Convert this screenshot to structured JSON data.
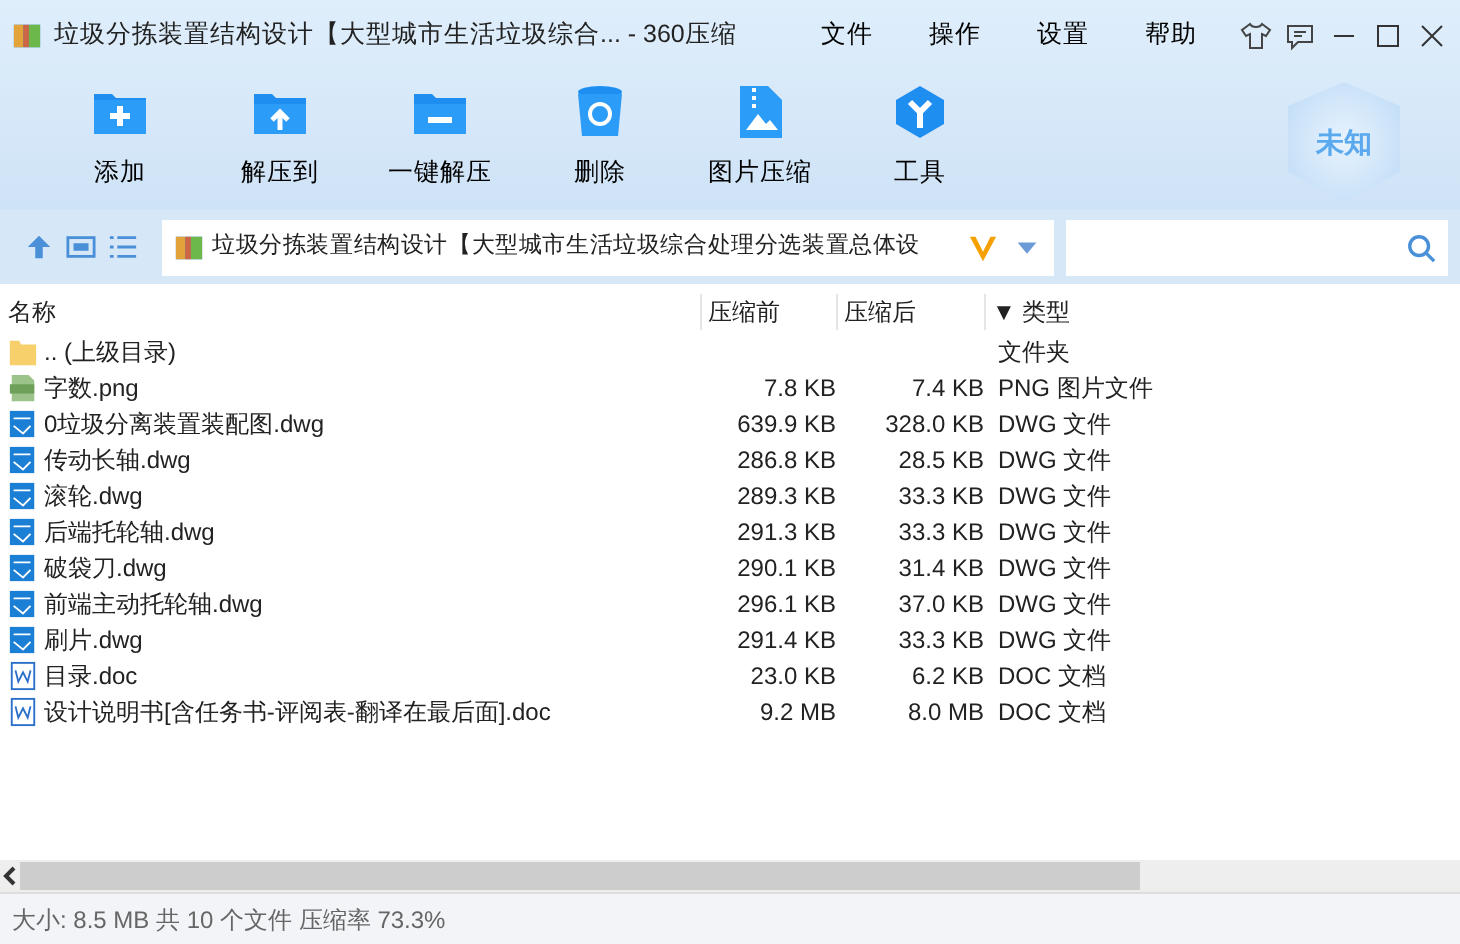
{
  "window": {
    "title": "垃圾分拣装置结构设计【大型城市生活垃圾综合... - 360压缩"
  },
  "menu": [
    "文件",
    "操作",
    "设置",
    "帮助"
  ],
  "toolbar": [
    {
      "kind": "add",
      "label": "添加"
    },
    {
      "kind": "extract",
      "label": "解压到"
    },
    {
      "kind": "oneclick",
      "label": "一键解压"
    },
    {
      "kind": "delete",
      "label": "删除"
    },
    {
      "kind": "image",
      "label": "图片压缩"
    },
    {
      "kind": "tools",
      "label": "工具"
    }
  ],
  "badge": "未知",
  "address": {
    "path": "垃圾分拣装置结构设计【大型城市生活垃圾综合处理分选装置总体设"
  },
  "table": {
    "columns": [
      "名称",
      "压缩前",
      "压缩后",
      "▼ 类型"
    ],
    "rows": [
      {
        "kind": "folder",
        "name": ".. (上级目录)",
        "type": "文件夹"
      },
      {
        "kind": "png",
        "name": "字数.png",
        "before": "7.8 KB",
        "after": "7.4 KB",
        "type": "PNG 图片文件"
      },
      {
        "kind": "dwg",
        "name": "0垃圾分离装置装配图.dwg",
        "before": "639.9 KB",
        "after": "328.0 KB",
        "type": "DWG 文件"
      },
      {
        "kind": "dwg",
        "name": "传动长轴.dwg",
        "before": "286.8 KB",
        "after": "28.5 KB",
        "type": "DWG 文件"
      },
      {
        "kind": "dwg",
        "name": "滚轮.dwg",
        "before": "289.3 KB",
        "after": "33.3 KB",
        "type": "DWG 文件"
      },
      {
        "kind": "dwg",
        "name": "后端托轮轴.dwg",
        "before": "291.3 KB",
        "after": "33.3 KB",
        "type": "DWG 文件"
      },
      {
        "kind": "dwg",
        "name": "破袋刀.dwg",
        "before": "290.1 KB",
        "after": "31.4 KB",
        "type": "DWG 文件"
      },
      {
        "kind": "dwg",
        "name": "前端主动托轮轴.dwg",
        "before": "296.1 KB",
        "after": "37.0 KB",
        "type": "DWG 文件"
      },
      {
        "kind": "dwg",
        "name": "刷片.dwg",
        "before": "291.4 KB",
        "after": "33.3 KB",
        "type": "DWG 文件"
      },
      {
        "kind": "doc",
        "name": "目录.doc",
        "before": "23.0 KB",
        "after": "6.2 KB",
        "type": "DOC 文档"
      },
      {
        "kind": "doc",
        "name": "设计说明书[含任务书-评阅表-翻译在最后面].doc",
        "before": "9.2 MB",
        "after": "8.0 MB",
        "type": "DOC 文档"
      }
    ]
  },
  "status_bar": "大小: 8.5 MB 共 10 个文件 压缩率 73.3%"
}
